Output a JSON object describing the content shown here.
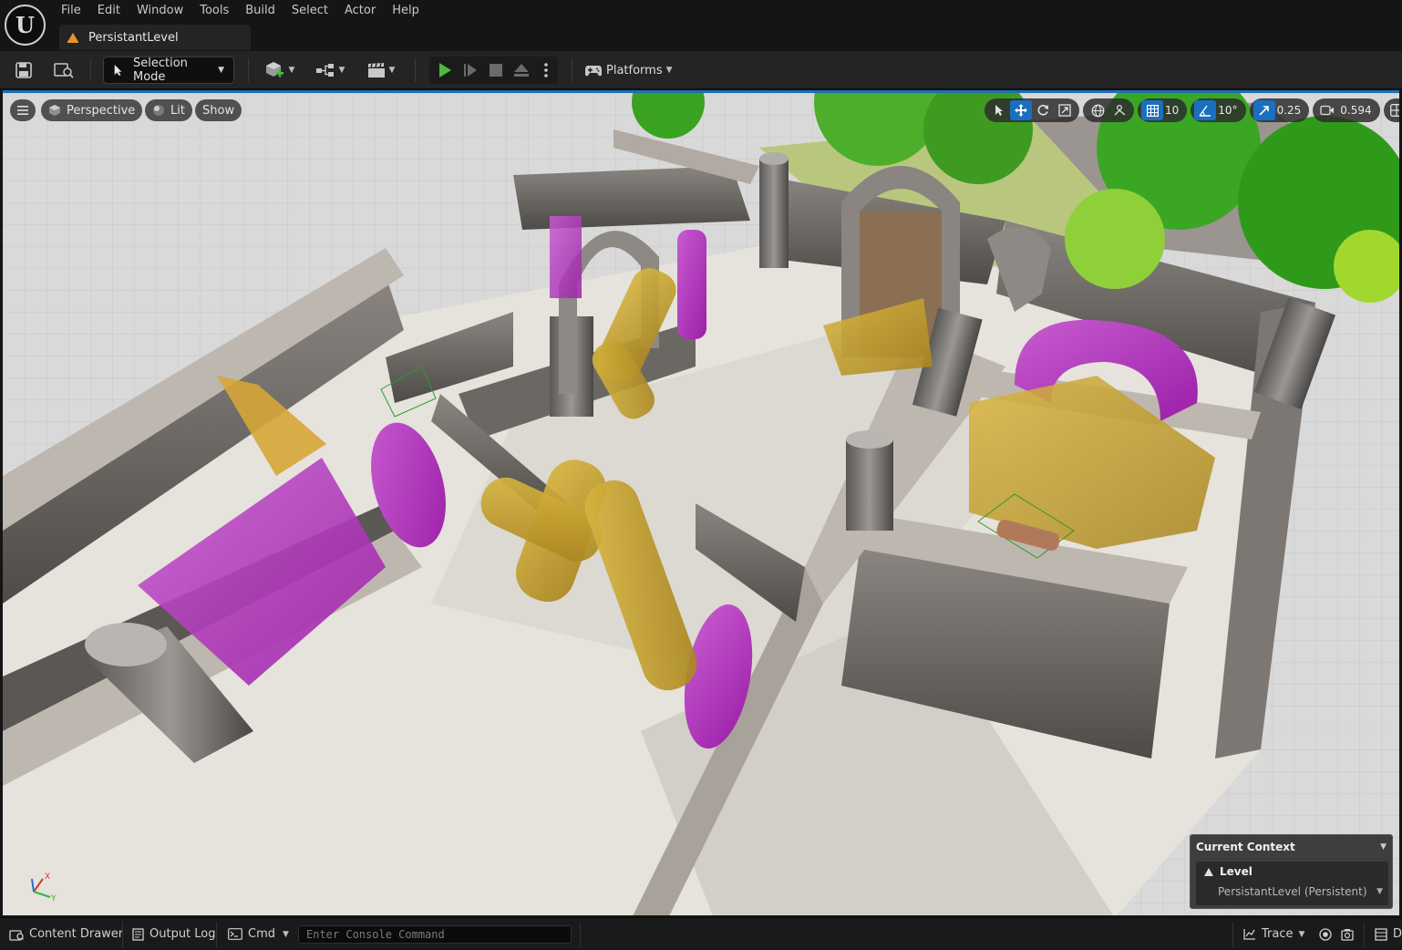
{
  "app": {
    "logo_letter": "U"
  },
  "menu": [
    "File",
    "Edit",
    "Window",
    "Tools",
    "Build",
    "Select",
    "Actor",
    "Help"
  ],
  "level_tab": {
    "label": "PersistantLevel"
  },
  "toolbar": {
    "selection_mode_label": "Selection Mode",
    "platforms_label": "Platforms"
  },
  "viewport": {
    "perspective_label": "Perspective",
    "lit_label": "Lit",
    "show_label": "Show",
    "grid_snap_value": "10",
    "rotation_snap_value": "10°",
    "scale_snap_value": "0.25",
    "camera_speed_value": "0.594",
    "accent_color": "#1a6fbf"
  },
  "context_panel": {
    "title": "Current Context",
    "level_label": "Level",
    "level_name": "PersistantLevel (Persistent)"
  },
  "statusbar": {
    "content_drawer_label": "Content Drawer",
    "output_log_label": "Output Log",
    "cmd_label": "Cmd",
    "console_placeholder": "Enter Console Command",
    "trace_label": "Trace",
    "derived_data_label": "D"
  }
}
